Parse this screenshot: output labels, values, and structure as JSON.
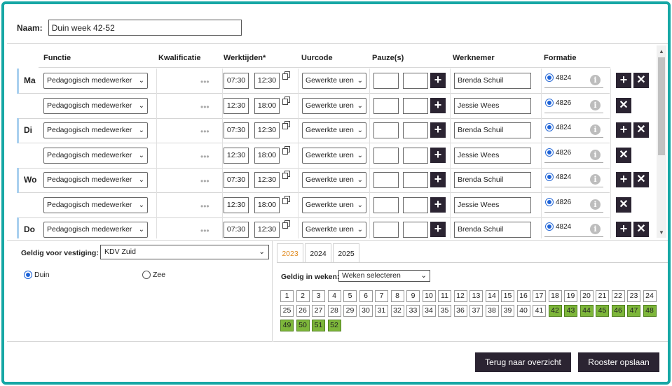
{
  "name_label": "Naam:",
  "name_value": "Duin week 42-52",
  "columns": {
    "functie": "Functie",
    "kwalificatie": "Kwalificatie",
    "werktijden": "Werktijden*",
    "uurcode": "Uurcode",
    "pauze": "Pauze(s)",
    "werknemer": "Werknemer",
    "formatie": "Formatie"
  },
  "rows": [
    {
      "day": "Ma",
      "functie": "Pedagogisch medewerker",
      "start": "07:30",
      "end": "12:30",
      "uurcode": "Gewerkte uren",
      "werknemer": "Brenda Schuil",
      "formatie": "4824",
      "has_add": true
    },
    {
      "day": "",
      "functie": "Pedagogisch medewerker",
      "start": "12:30",
      "end": "18:00",
      "uurcode": "Gewerkte uren",
      "werknemer": "Jessie Wees",
      "formatie": "4826",
      "has_add": false
    },
    {
      "day": "Di",
      "functie": "Pedagogisch medewerker",
      "start": "07:30",
      "end": "12:30",
      "uurcode": "Gewerkte uren",
      "werknemer": "Brenda Schuil",
      "formatie": "4824",
      "has_add": true
    },
    {
      "day": "",
      "functie": "Pedagogisch medewerker",
      "start": "12:30",
      "end": "18:00",
      "uurcode": "Gewerkte uren",
      "werknemer": "Jessie Wees",
      "formatie": "4826",
      "has_add": false
    },
    {
      "day": "Wo",
      "functie": "Pedagogisch medewerker",
      "start": "07:30",
      "end": "12:30",
      "uurcode": "Gewerkte uren",
      "werknemer": "Brenda Schuil",
      "formatie": "4824",
      "has_add": true
    },
    {
      "day": "",
      "functie": "Pedagogisch medewerker",
      "start": "12:30",
      "end": "18:00",
      "uurcode": "Gewerkte uren",
      "werknemer": "Jessie Wees",
      "formatie": "4826",
      "has_add": false
    },
    {
      "day": "Do",
      "functie": "Pedagogisch medewerker",
      "start": "07:30",
      "end": "12:30",
      "uurcode": "Gewerkte uren",
      "werknemer": "Brenda Schuil",
      "formatie": "4824",
      "has_add": true
    }
  ],
  "vestiging": {
    "label": "Geldig voor vestiging:",
    "value": "KDV Zuid",
    "options": [
      {
        "label": "Duin",
        "checked": true
      },
      {
        "label": "Zee",
        "checked": false
      }
    ]
  },
  "years": [
    {
      "label": "2023",
      "active": true
    },
    {
      "label": "2024",
      "active": false
    },
    {
      "label": "2025",
      "active": false
    }
  ],
  "weken": {
    "label": "Geldig in weken:",
    "select_value": "Weken selecteren",
    "weeks": [
      "1",
      "2",
      "3",
      "4",
      "5",
      "6",
      "7",
      "8",
      "9",
      "10",
      "11",
      "12",
      "13",
      "14",
      "15",
      "16",
      "17",
      "18",
      "19",
      "20",
      "21",
      "22",
      "23",
      "24",
      "25",
      "26",
      "27",
      "28",
      "29",
      "30",
      "31",
      "32",
      "33",
      "34",
      "35",
      "36",
      "37",
      "38",
      "39",
      "40",
      "41",
      "42",
      "43",
      "44",
      "45",
      "46",
      "47",
      "48",
      "49",
      "50",
      "51",
      "52"
    ],
    "selected": [
      "42",
      "43",
      "44",
      "45",
      "46",
      "47",
      "48",
      "49",
      "50",
      "51",
      "52"
    ],
    "selected_color": "#7db63a"
  },
  "buttons": {
    "back": "Terug naar overzicht",
    "save": "Rooster opslaan"
  },
  "colors": {
    "frame": "#16a7a5",
    "button": "#2b2432",
    "active_tab": "#e08a1e",
    "day_bar": "#a9d0ef"
  }
}
